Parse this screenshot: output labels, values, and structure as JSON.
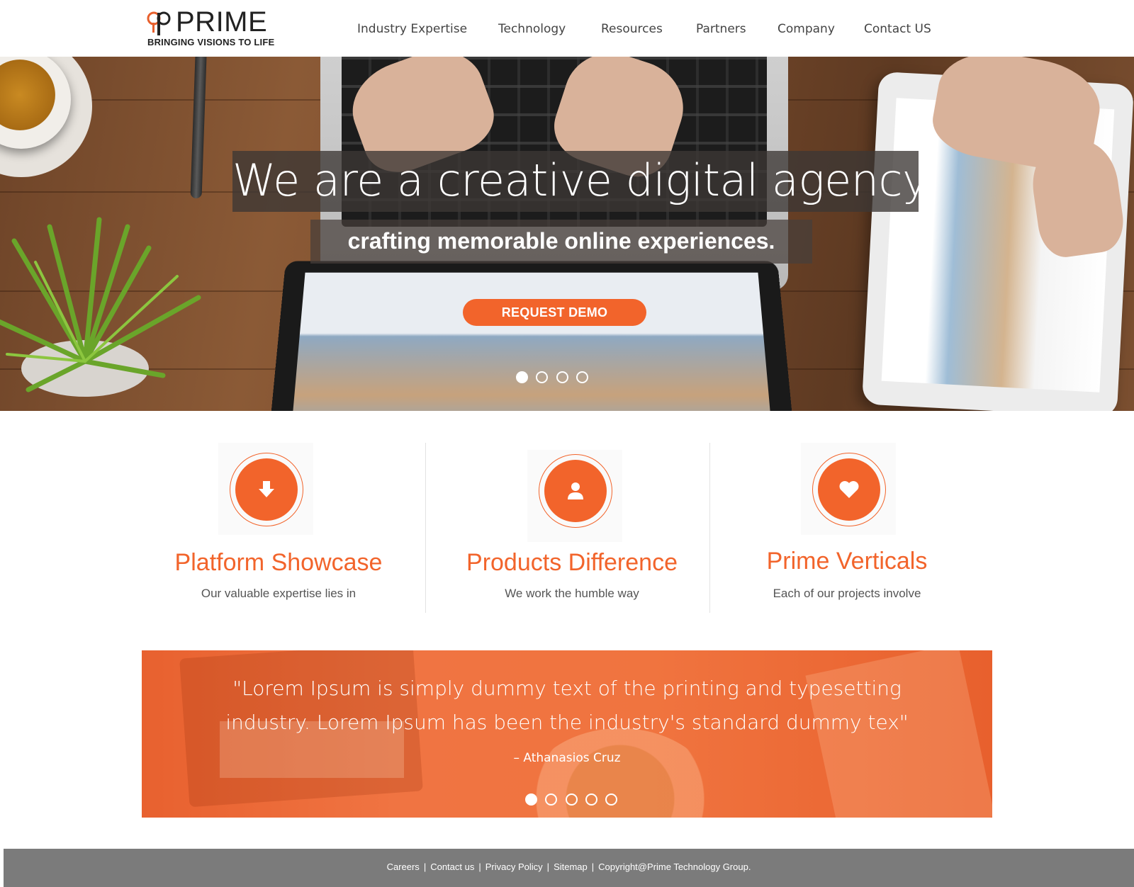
{
  "brand": {
    "name": "PRIME",
    "tagline": "BRINGING VISIONS TO LIFE",
    "accent_color": "#f2642b"
  },
  "nav": {
    "items": [
      {
        "label": "Industry Expertise"
      },
      {
        "label": "Technology"
      },
      {
        "label": "Resources"
      },
      {
        "label": "Partners"
      },
      {
        "label": "Company"
      },
      {
        "label": "Contact US"
      }
    ]
  },
  "hero": {
    "title": "We are a creative digital agency",
    "subtitle": "crafting memorable online experiences.",
    "cta_label": "REQUEST DEMO",
    "slide_count": 4,
    "active_slide": 1
  },
  "features": [
    {
      "icon": "arrow-down-icon",
      "title": "Platform Showcase",
      "subtitle": "Our valuable expertise lies in"
    },
    {
      "icon": "user-icon",
      "title": "Products Difference",
      "subtitle": "We work the humble way"
    },
    {
      "icon": "heart-icon",
      "title": "Prime Verticals",
      "subtitle": "Each of our projects involve"
    }
  ],
  "testimonial": {
    "quote_line1": "\"Lorem Ipsum is simply dummy text of the printing and typesetting",
    "quote_line2": "industry. Lorem Ipsum has been the industry's standard dummy tex\"",
    "author": "– Athanasios Cruz",
    "slide_count": 5,
    "active_slide": 1
  },
  "footer": {
    "links": [
      {
        "label": "Careers"
      },
      {
        "label": "Contact us"
      },
      {
        "label": "Privacy Policy"
      },
      {
        "label": "Sitemap"
      }
    ],
    "copyright": "Copyright@Prime Technology Group.",
    "separator": "|"
  }
}
